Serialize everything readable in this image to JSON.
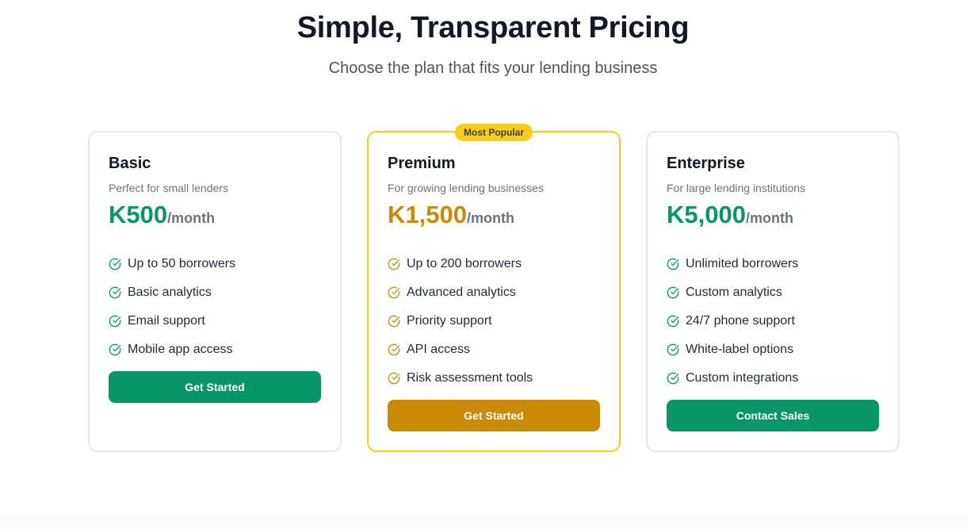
{
  "header": {
    "title": "Simple, Transparent Pricing",
    "subtitle": "Choose the plan that fits your lending business"
  },
  "colors": {
    "brand_green": "#069668",
    "premium_gold": "#ca8a04",
    "badge_yellow": "#facc15"
  },
  "plans": [
    {
      "name": "Basic",
      "description": "Perfect for small lenders",
      "price": "K500",
      "period": "/month",
      "features": [
        "Up to 50 borrowers",
        "Basic analytics",
        "Email support",
        "Mobile app access"
      ],
      "cta": "Get Started",
      "icon": "check-circle-icon"
    },
    {
      "name": "Premium",
      "badge": "Most Popular",
      "description": "For growing lending businesses",
      "price": "K1,500",
      "period": "/month",
      "features": [
        "Up to 200 borrowers",
        "Advanced analytics",
        "Priority support",
        "API access",
        "Risk assessment tools"
      ],
      "cta": "Get Started",
      "icon": "check-circle-icon"
    },
    {
      "name": "Enterprise",
      "description": "For large lending institutions",
      "price": "K5,000",
      "period": "/month",
      "features": [
        "Unlimited borrowers",
        "Custom analytics",
        "24/7 phone support",
        "White-label options",
        "Custom integrations"
      ],
      "cta": "Contact Sales",
      "icon": "check-circle-icon"
    }
  ]
}
